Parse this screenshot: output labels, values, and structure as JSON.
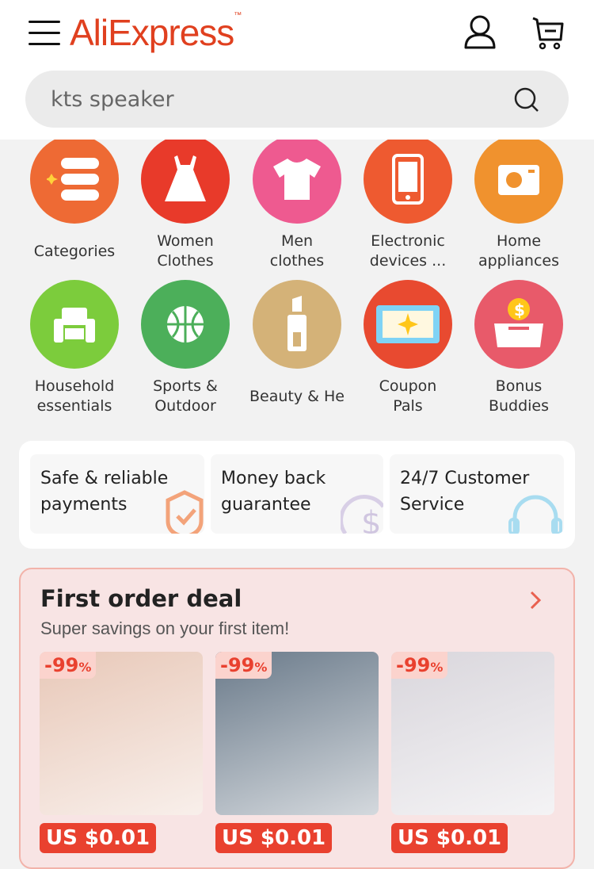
{
  "header": {
    "logo": "AliExpress",
    "search_value": "kts speaker"
  },
  "categories": [
    {
      "label": "Categories",
      "color": "#ee6a34",
      "icon": "list-icon"
    },
    {
      "label": "Women\nClothes",
      "color": "#e83a2a",
      "icon": "dress-icon"
    },
    {
      "label": "Men\nclothes",
      "color": "#ee5a90",
      "icon": "tshirt-icon"
    },
    {
      "label": "Electronic\ndevices ...",
      "color": "#ee5a30",
      "icon": "phone-icon"
    },
    {
      "label": "Home\nappliances",
      "color": "#f0922e",
      "icon": "camera-icon"
    },
    {
      "label": "Household\nessentials",
      "color": "#7ccc3c",
      "icon": "sofa-icon"
    },
    {
      "label": "Sports &\nOutdoor",
      "color": "#4caf5a",
      "icon": "basketball-icon"
    },
    {
      "label": "Beauty & He",
      "color": "#d4b278",
      "icon": "lipstick-icon"
    },
    {
      "label": "Coupon\nPals",
      "color": "#e84a30",
      "icon": "coupon-icon"
    },
    {
      "label": "Bonus\nBuddies",
      "color": "#e85a6a",
      "icon": "piggy-bank-icon"
    }
  ],
  "trust": [
    {
      "label": "Safe & reliable payments",
      "icon": "shield-check-icon"
    },
    {
      "label": "Money back guarantee",
      "icon": "dollar-icon"
    },
    {
      "label": "24/7 Customer Service",
      "icon": "headset-icon"
    }
  ],
  "deal": {
    "title": "First order deal",
    "subtitle": "Super savings on your first item!",
    "products": [
      {
        "discount": "-99",
        "pct": "%",
        "price": "US $0.01",
        "bg": "#e8c8b8"
      },
      {
        "discount": "-99",
        "pct": "%",
        "price": "US $0.01",
        "bg": "#6a7a8a"
      },
      {
        "discount": "-99",
        "pct": "%",
        "price": "US $0.01",
        "bg": "#d9d6dc"
      }
    ]
  }
}
